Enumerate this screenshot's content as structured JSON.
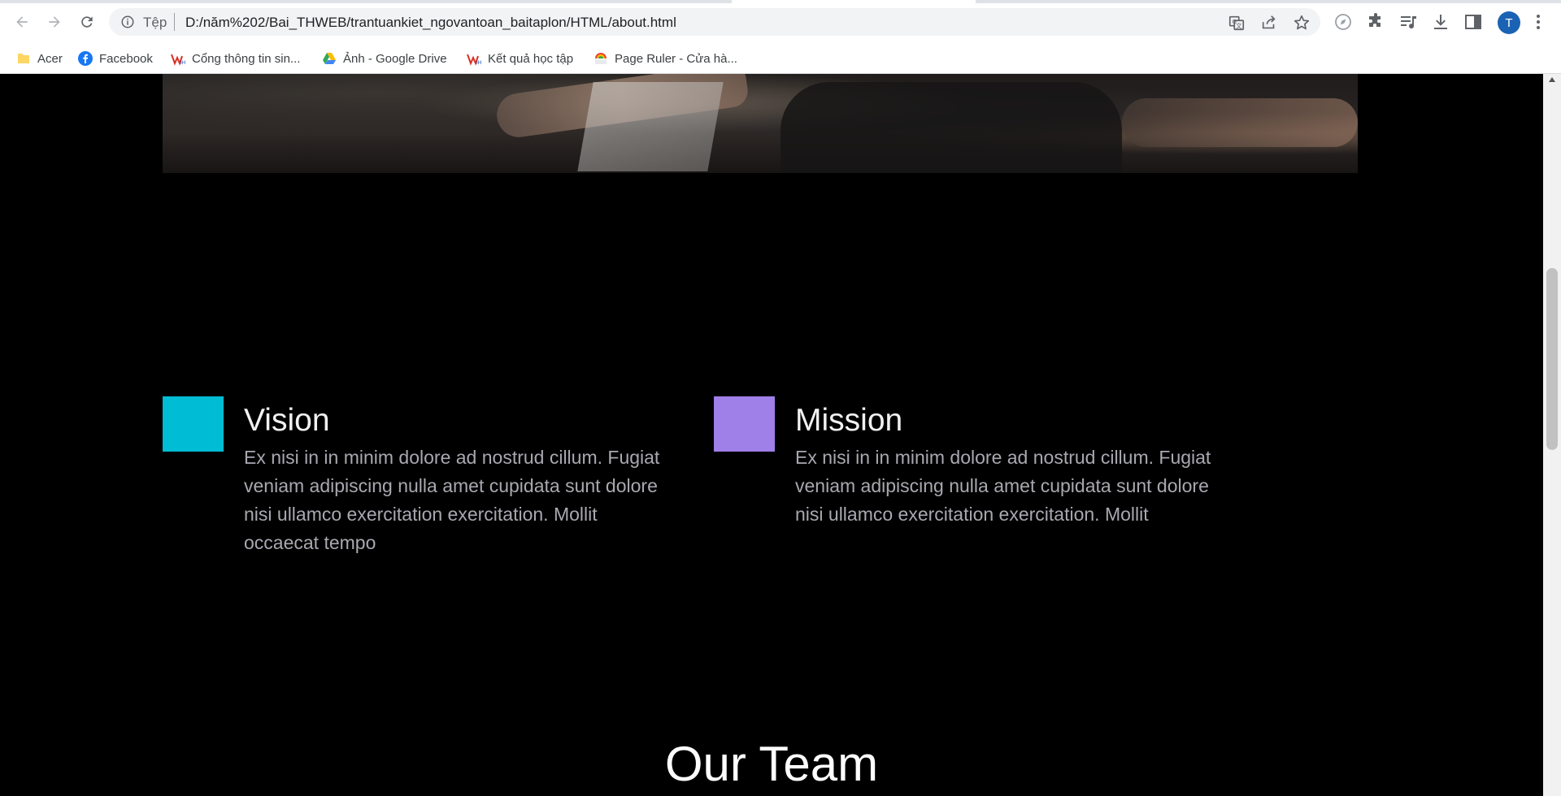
{
  "browser": {
    "url_scheme": "Tệp",
    "url": "D:/năm%202/Bai_THWEB/trantuankiet_ngovantoan_baitaplon/HTML/about.html",
    "profile_initial": "T",
    "icons": [
      "back-icon",
      "forward-icon",
      "reload-icon",
      "info-icon",
      "translate-icon",
      "share-icon",
      "star-icon",
      "compass-icon",
      "extensions-icon",
      "media-icon",
      "download-icon",
      "side-panel-icon",
      "menu-icon"
    ]
  },
  "bookmarks": [
    {
      "label": "Acer",
      "icon": "folder-icon",
      "color": "#fdd663"
    },
    {
      "label": "Facebook",
      "icon": "facebook-icon",
      "color": "#1877f2"
    },
    {
      "label": "Cổng thông tin sin...",
      "icon": "vnua-logo-icon",
      "color": "#d93025"
    },
    {
      "label": "Ảnh - Google Drive",
      "icon": "google-drive-icon",
      "color": "#34a853"
    },
    {
      "label": "Kết quả học tập",
      "icon": "vnua-logo-icon",
      "color": "#d93025"
    },
    {
      "label": "Page Ruler - Cửa hà...",
      "icon": "chrome-store-icon",
      "color": "#ea4335"
    }
  ],
  "page": {
    "background": "#000000",
    "vision": {
      "title": "Vision",
      "text": "Ex nisi in in minim dolore ad nostrud cillum. Fugiat veniam adipiscing nulla amet cupidata sunt dolore nisi ullamco exercitation exercitation. Mollit occaecat tempo",
      "color": "#00bcd4"
    },
    "mission": {
      "title": "Mission",
      "text": "Ex nisi in in minim dolore ad nostrud cillum. Fugiat veniam adipiscing nulla amet cupidata sunt dolore nisi ullamco exercitation exercitation. Mollit",
      "color": "#9f7fe8"
    },
    "team_title": "Our Team"
  }
}
